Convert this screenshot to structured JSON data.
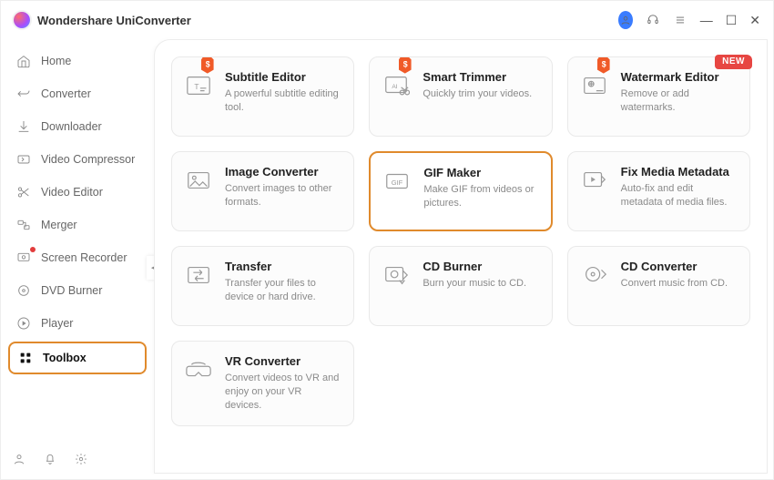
{
  "app": {
    "title": "Wondershare UniConverter"
  },
  "titlebar": {
    "account_icon": "user",
    "headset_icon": "support",
    "menu_icon": "hamburger",
    "min": "min",
    "max": "max",
    "close": "close"
  },
  "sidebar": {
    "items": [
      {
        "label": "Home",
        "icon": "home"
      },
      {
        "label": "Converter",
        "icon": "convert"
      },
      {
        "label": "Downloader",
        "icon": "download"
      },
      {
        "label": "Video Compressor",
        "icon": "compress"
      },
      {
        "label": "Video Editor",
        "icon": "scissors"
      },
      {
        "label": "Merger",
        "icon": "merge"
      },
      {
        "label": "Screen Recorder",
        "icon": "record",
        "red_dot": true
      },
      {
        "label": "DVD Burner",
        "icon": "disc"
      },
      {
        "label": "Player",
        "icon": "play"
      },
      {
        "label": "Toolbox",
        "icon": "grid",
        "active": true
      }
    ],
    "footer": {
      "user": "user",
      "bell": "notifications",
      "settings": "gear"
    }
  },
  "tools": [
    {
      "title": "Subtitle Editor",
      "desc": "A powerful subtitle editing tool.",
      "icon": "subtitle",
      "sale": true
    },
    {
      "title": "Smart Trimmer",
      "desc": "Quickly trim your videos.",
      "icon": "trim",
      "sale": true
    },
    {
      "title": "Watermark Editor",
      "desc": "Remove or add watermarks.",
      "icon": "watermark",
      "sale": true,
      "new": true
    },
    {
      "title": "Image Converter",
      "desc": "Convert images to other formats.",
      "icon": "image"
    },
    {
      "title": "GIF Maker",
      "desc": "Make GIF from videos or pictures.",
      "icon": "gif",
      "highlight": true
    },
    {
      "title": "Fix Media Metadata",
      "desc": "Auto-fix and edit metadata of media files.",
      "icon": "metadata"
    },
    {
      "title": "Transfer",
      "desc": "Transfer your files to device or hard drive.",
      "icon": "transfer"
    },
    {
      "title": "CD Burner",
      "desc": "Burn your music to CD.",
      "icon": "cdburn"
    },
    {
      "title": "CD Converter",
      "desc": "Convert music from CD.",
      "icon": "cdconv"
    },
    {
      "title": "VR Converter",
      "desc": "Convert videos to VR and enjoy on your VR devices.",
      "icon": "vr"
    }
  ],
  "badges": {
    "new_label": "NEW"
  }
}
